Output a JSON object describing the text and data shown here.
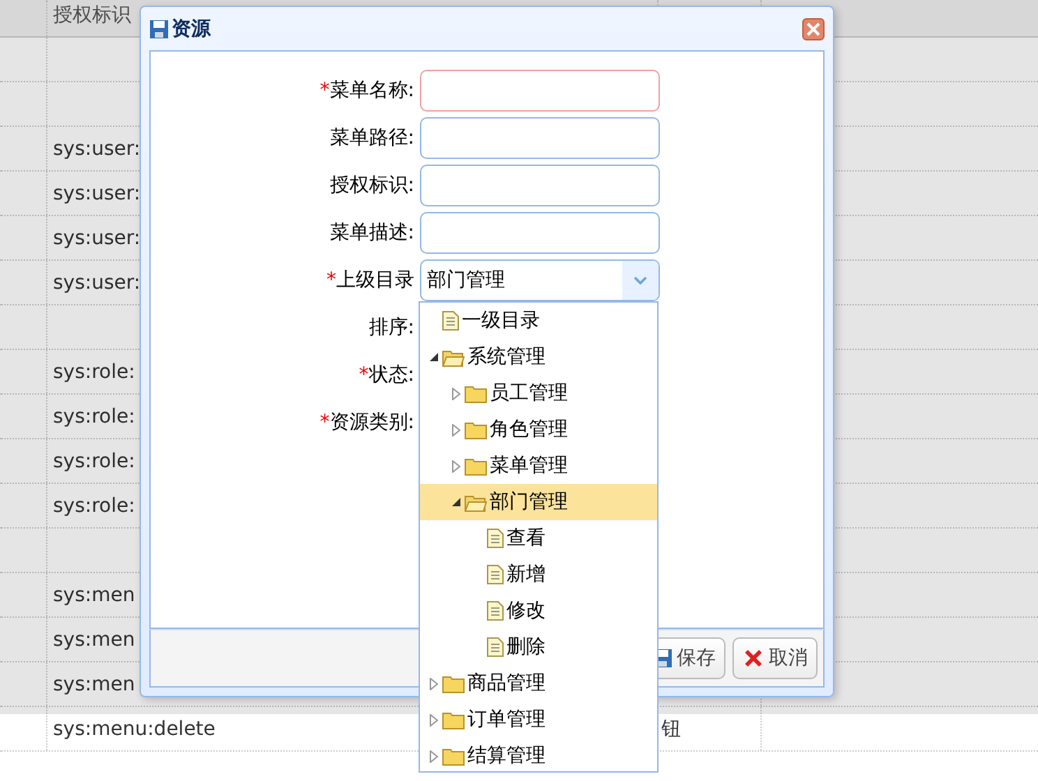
{
  "background_table": {
    "header": {
      "column_2": "授权标识"
    },
    "rows": [
      {},
      {},
      {
        "column_2": "sys:user:"
      },
      {
        "column_2": "sys:user:"
      },
      {
        "column_2": "sys:user:"
      },
      {
        "column_2": "sys:user:"
      },
      {},
      {
        "column_2": "sys:role:"
      },
      {
        "column_2": "sys:role:"
      },
      {
        "column_2": "sys:role:"
      },
      {
        "column_2": "sys:role:"
      },
      {},
      {
        "column_2": "sys:men"
      },
      {
        "column_2": "sys:men"
      },
      {
        "column_2": "sys:men"
      },
      {
        "column_2": "sys:menu:delete",
        "column_4": "钮"
      }
    ]
  },
  "dialog": {
    "title": "资源",
    "fields": [
      {
        "kind": "text",
        "required_mark": "*",
        "label": "菜单名称:",
        "invalid": true
      },
      {
        "kind": "text",
        "label": "菜单路径:",
        "invalid": false
      },
      {
        "kind": "text",
        "label": "授权标识:",
        "invalid": false
      },
      {
        "kind": "text",
        "label": "菜单描述:",
        "invalid": false
      },
      {
        "kind": "combo",
        "required_mark": "*",
        "label": "上级目录",
        "value": "部门管理"
      },
      {
        "kind": "covered",
        "label": "排序:"
      },
      {
        "kind": "covered",
        "required_mark": "*",
        "label": "状态:"
      },
      {
        "kind": "covered",
        "required_mark": "*",
        "label": "资源类别:"
      }
    ],
    "buttons": [
      {
        "kind": "save",
        "label": "保存"
      },
      {
        "kind": "cancel",
        "label": "取消"
      }
    ]
  },
  "dropdown_tree": [
    {
      "kind": "file",
      "label": "一级目录",
      "selected": false
    },
    {
      "kind": "folder",
      "label": "系统管理",
      "selected": false,
      "expanded": true,
      "children": [
        {
          "kind": "folder",
          "label": "员工管理",
          "selected": false,
          "expanded": false
        },
        {
          "kind": "folder",
          "label": "角色管理",
          "selected": false,
          "expanded": false
        },
        {
          "kind": "folder",
          "label": "菜单管理",
          "selected": false,
          "expanded": false
        },
        {
          "kind": "folder",
          "label": "部门管理",
          "selected": true,
          "expanded": true,
          "children": [
            {
              "kind": "file",
              "label": "查看",
              "selected": false
            },
            {
              "kind": "file",
              "label": "新增",
              "selected": false
            },
            {
              "kind": "file",
              "label": "修改",
              "selected": false
            },
            {
              "kind": "file",
              "label": "删除",
              "selected": false
            }
          ]
        }
      ]
    },
    {
      "kind": "folder",
      "label": "商品管理",
      "selected": false,
      "expanded": false
    },
    {
      "kind": "folder",
      "label": "订单管理",
      "selected": false,
      "expanded": false
    },
    {
      "kind": "folder",
      "label": "结算管理",
      "selected": false,
      "expanded": false
    }
  ]
}
